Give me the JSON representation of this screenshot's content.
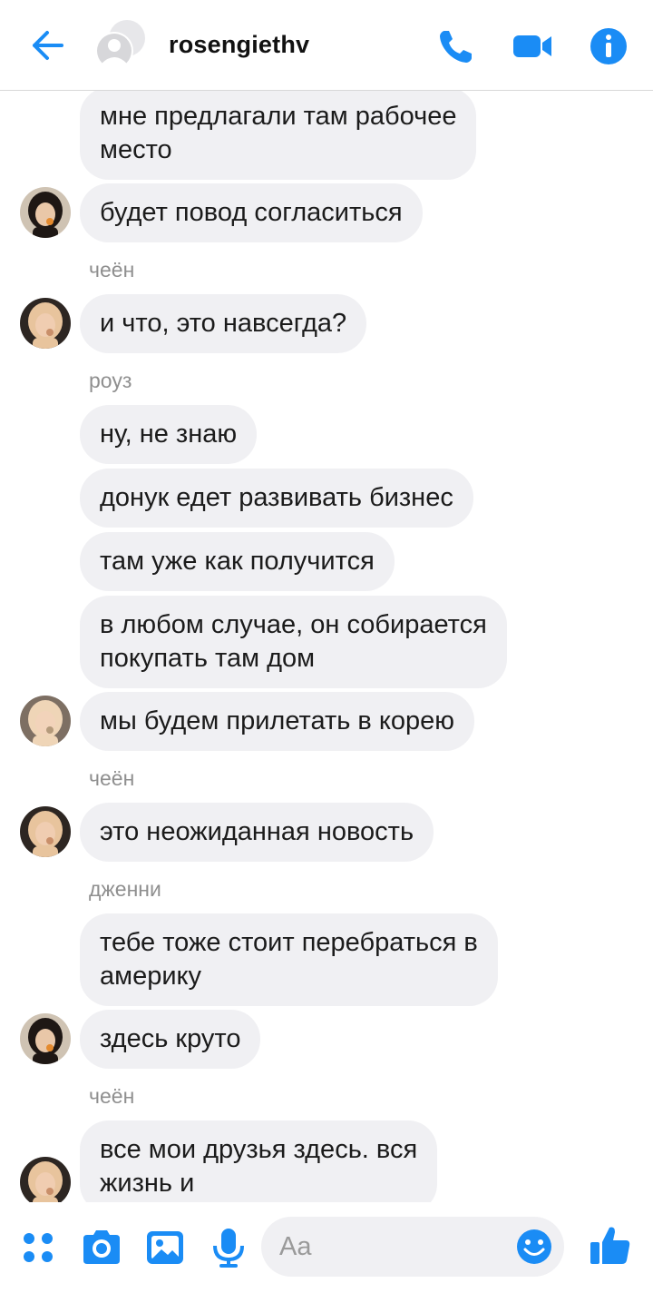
{
  "header": {
    "contact_name": "rosengiethv"
  },
  "messages": [
    {
      "type": "bubble",
      "text": [
        "мне предлагали там рабочее",
        "место"
      ]
    },
    {
      "type": "bubble",
      "text": [
        "будет повод согласиться"
      ],
      "avatar": "jennie"
    },
    {
      "type": "label",
      "text": "чеён"
    },
    {
      "type": "bubble",
      "text": [
        "и что, это навсегда?"
      ],
      "avatar": "chaeyoung"
    },
    {
      "type": "label",
      "text": "роуз"
    },
    {
      "type": "bubble",
      "text": [
        "ну, не знаю"
      ]
    },
    {
      "type": "bubble",
      "text": [
        "донук едет развивать бизнес"
      ]
    },
    {
      "type": "bubble",
      "text": [
        "там уже как получится"
      ]
    },
    {
      "type": "bubble",
      "text": [
        "в любом случае, он собирается",
        "покупать там дом"
      ]
    },
    {
      "type": "bubble",
      "text": [
        "мы будем прилетать в корею"
      ],
      "avatar": "rose"
    },
    {
      "type": "label",
      "text": "чеён"
    },
    {
      "type": "bubble",
      "text": [
        "это неожиданная новость"
      ],
      "avatar": "chaeyoung"
    },
    {
      "type": "label",
      "text": "дженни"
    },
    {
      "type": "bubble",
      "text": [
        "тебе тоже стоит перебраться в",
        "америку"
      ]
    },
    {
      "type": "bubble",
      "text": [
        "здесь круто"
      ],
      "avatar": "jennie"
    },
    {
      "type": "label",
      "text": "чеён"
    },
    {
      "type": "bubble",
      "text": [
        "все мои друзья здесь. вся",
        "жизнь и"
      ],
      "avatar": "chaeyoung"
    }
  ],
  "composer": {
    "placeholder": "Aa"
  },
  "colors": {
    "accent": "#1a8cf5",
    "bubble_bg": "#f0f0f3",
    "label": "#8f8f8f"
  }
}
